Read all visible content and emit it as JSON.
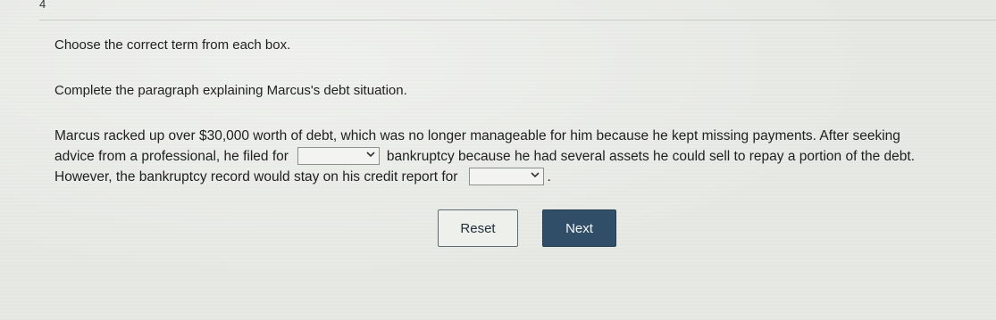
{
  "question_number": "4",
  "instruction": "Choose the correct term from each box.",
  "prompt": "Complete the paragraph explaining Marcus's debt situation.",
  "paragraph": {
    "line1": "Marcus racked up over $30,000 worth of debt, which was no longer manageable for him because he kept missing payments. After seeking",
    "line2_before": "advice from a professional, he filed for",
    "line2_after": "bankruptcy because he had several assets he could sell to repay a portion of the debt.",
    "line3_before": "However, the bankruptcy record would stay on his credit report for",
    "line3_after": "."
  },
  "dropdowns": {
    "bankruptcy_type": {
      "selected": ""
    },
    "credit_duration": {
      "selected": ""
    }
  },
  "buttons": {
    "reset_label": "Reset",
    "next_label": "Next"
  },
  "colors": {
    "next_bg": "#304e68",
    "background": "#e7e9e4"
  }
}
